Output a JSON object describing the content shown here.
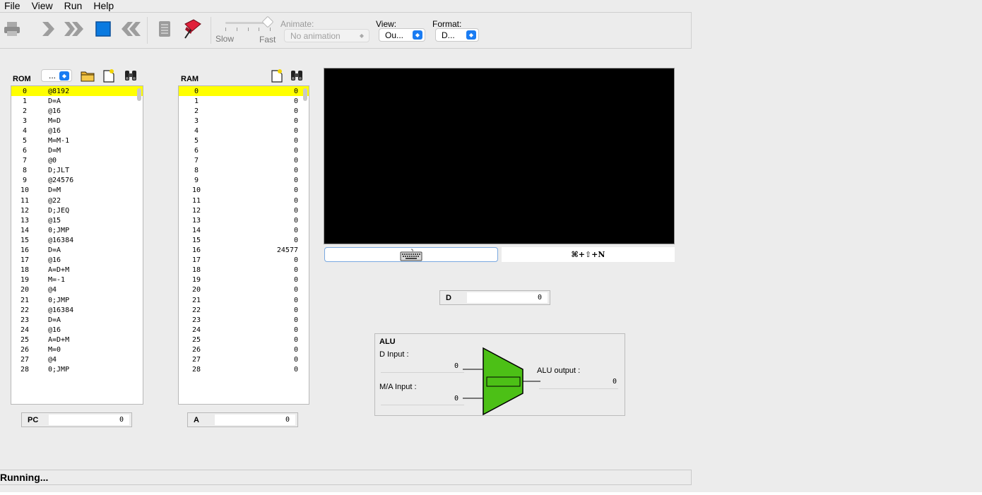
{
  "menu": [
    "File",
    "View",
    "Run",
    "Help"
  ],
  "toolbar": {
    "speed_slow": "Slow",
    "speed_fast": "Fast",
    "speed_level": 1.0,
    "animate_label": "Animate:",
    "animate_value": "No animation",
    "view_label": "View:",
    "view_value": "Ou...",
    "format_label": "Format:",
    "format_value": "D..."
  },
  "rom": {
    "title": "ROM",
    "format_value": "...",
    "selected_index": 0,
    "rows": [
      {
        "i": "0",
        "v": "@8192"
      },
      {
        "i": "1",
        "v": "D=A"
      },
      {
        "i": "2",
        "v": "@16"
      },
      {
        "i": "3",
        "v": "M=D"
      },
      {
        "i": "4",
        "v": "@16"
      },
      {
        "i": "5",
        "v": "M=M-1"
      },
      {
        "i": "6",
        "v": "D=M"
      },
      {
        "i": "7",
        "v": "@0"
      },
      {
        "i": "8",
        "v": "D;JLT"
      },
      {
        "i": "9",
        "v": "@24576"
      },
      {
        "i": "10",
        "v": "D=M"
      },
      {
        "i": "11",
        "v": "@22"
      },
      {
        "i": "12",
        "v": "D;JEQ"
      },
      {
        "i": "13",
        "v": "@15"
      },
      {
        "i": "14",
        "v": "0;JMP"
      },
      {
        "i": "15",
        "v": "@16384"
      },
      {
        "i": "16",
        "v": "D=A"
      },
      {
        "i": "17",
        "v": "@16"
      },
      {
        "i": "18",
        "v": "A=D+M"
      },
      {
        "i": "19",
        "v": "M=-1"
      },
      {
        "i": "20",
        "v": "@4"
      },
      {
        "i": "21",
        "v": "0;JMP"
      },
      {
        "i": "22",
        "v": "@16384"
      },
      {
        "i": "23",
        "v": "D=A"
      },
      {
        "i": "24",
        "v": "@16"
      },
      {
        "i": "25",
        "v": "A=D+M"
      },
      {
        "i": "26",
        "v": "M=0"
      },
      {
        "i": "27",
        "v": "@4"
      },
      {
        "i": "28",
        "v": "0;JMP"
      }
    ]
  },
  "ram": {
    "title": "RAM",
    "selected_index": 0,
    "rows": [
      {
        "i": "0",
        "v": "0"
      },
      {
        "i": "1",
        "v": "0"
      },
      {
        "i": "2",
        "v": "0"
      },
      {
        "i": "3",
        "v": "0"
      },
      {
        "i": "4",
        "v": "0"
      },
      {
        "i": "5",
        "v": "0"
      },
      {
        "i": "6",
        "v": "0"
      },
      {
        "i": "7",
        "v": "0"
      },
      {
        "i": "8",
        "v": "0"
      },
      {
        "i": "9",
        "v": "0"
      },
      {
        "i": "10",
        "v": "0"
      },
      {
        "i": "11",
        "v": "0"
      },
      {
        "i": "12",
        "v": "0"
      },
      {
        "i": "13",
        "v": "0"
      },
      {
        "i": "14",
        "v": "0"
      },
      {
        "i": "15",
        "v": "0"
      },
      {
        "i": "16",
        "v": "24577"
      },
      {
        "i": "17",
        "v": "0"
      },
      {
        "i": "18",
        "v": "0"
      },
      {
        "i": "19",
        "v": "0"
      },
      {
        "i": "20",
        "v": "0"
      },
      {
        "i": "21",
        "v": "0"
      },
      {
        "i": "22",
        "v": "0"
      },
      {
        "i": "23",
        "v": "0"
      },
      {
        "i": "24",
        "v": "0"
      },
      {
        "i": "25",
        "v": "0"
      },
      {
        "i": "26",
        "v": "0"
      },
      {
        "i": "27",
        "v": "0"
      },
      {
        "i": "28",
        "v": "0"
      }
    ]
  },
  "registers": {
    "pc": {
      "name": "PC",
      "value": "0"
    },
    "a": {
      "name": "A",
      "value": "0"
    },
    "d": {
      "name": "D",
      "value": "0"
    }
  },
  "keyboard": {
    "hint": "⌘+⇧+N",
    "icon": "keyboard-icon"
  },
  "alu": {
    "title": "ALU",
    "d_input_label": "D Input :",
    "d_input_value": "0",
    "ma_input_label": "M/A Input :",
    "ma_input_value": "0",
    "output_label": "ALU output :",
    "output_value": "0",
    "color": "#4cc016"
  },
  "status": "Running..."
}
